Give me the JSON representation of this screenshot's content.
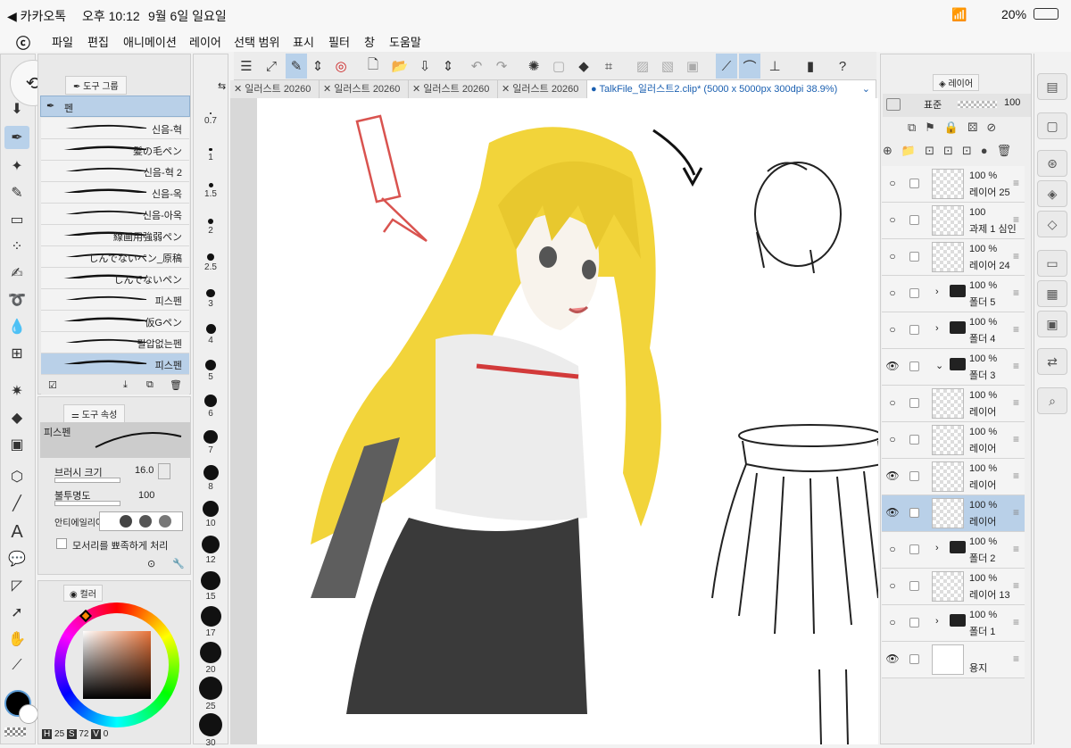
{
  "status_bar": {
    "back": "◀ 카카오톡",
    "time": "오후 10:12",
    "date": "9월 6일 일요일",
    "battery": "20%"
  },
  "menu": [
    "파일",
    "편집",
    "애니메이션",
    "레이어",
    "선택 범위",
    "표시",
    "필터",
    "창",
    "도움말"
  ],
  "sub_tool_panel": {
    "tab": "도구 그룹",
    "group": "펜",
    "brushes": [
      "신음-혁",
      "髪の毛ペン",
      "신음-혁 2",
      "신음-옥",
      "신음-아옥",
      "線画用強弱ペン",
      "しんでないペン_原稿",
      "しんでないペン",
      "피스펜",
      "仮Gペン",
      "필압없는펜",
      "피스펜"
    ]
  },
  "tool_property": {
    "tab": "도구 속성",
    "name": "피스펜",
    "brush_size_label": "브러시 크기",
    "brush_size": "16.0",
    "opacity_label": "불투명도",
    "opacity": "100",
    "antialias_label": "안티에일리어",
    "sharpen_label": "모서리를 뾰족하게 처리"
  },
  "color_panel": {
    "tab": "컬러",
    "h": "25",
    "s": "72",
    "v": "0",
    "h_label": "H",
    "s_label": "S",
    "v_label": "V"
  },
  "brush_size_ruler": [
    "0.7",
    "1",
    "1.5",
    "2",
    "2.5",
    "3",
    "4",
    "5",
    "6",
    "7",
    "8",
    "10",
    "12",
    "15",
    "17",
    "20",
    "25",
    "30"
  ],
  "tabs": [
    "일러스트 20260",
    "일러스트 20260",
    "일러스트 20260",
    "일러스트 20260",
    "TalkFile_일러스트2.clip* (5000 x 5000px 300dpi 38.9%)"
  ],
  "layer_panel": {
    "tab": "레이어",
    "blend": "표준",
    "opacity": "100",
    "layers": [
      {
        "pct": "100 %",
        "name": "레이어 25",
        "type": "layer",
        "visible": false,
        "selected": false
      },
      {
        "pct": "100",
        "name": "과제 1 심인",
        "type": "text",
        "visible": false,
        "selected": false
      },
      {
        "pct": "100 %",
        "name": "레이어 24",
        "type": "layer",
        "visible": false,
        "selected": false
      },
      {
        "pct": "100 %",
        "name": "폴더 5",
        "type": "folder",
        "visible": false,
        "selected": false
      },
      {
        "pct": "100 %",
        "name": "폴더 4",
        "type": "folder",
        "visible": false,
        "selected": false
      },
      {
        "pct": "100 %",
        "name": "폴더 3",
        "type": "folder-open",
        "visible": true,
        "selected": false
      },
      {
        "pct": "100 %",
        "name": "레이어",
        "type": "layer",
        "visible": false,
        "selected": false
      },
      {
        "pct": "100 %",
        "name": "레이어",
        "type": "layer",
        "visible": false,
        "selected": false
      },
      {
        "pct": "100 %",
        "name": "레이어",
        "type": "layer",
        "visible": true,
        "selected": false
      },
      {
        "pct": "100 %",
        "name": "레이어",
        "type": "layer",
        "visible": true,
        "selected": true
      },
      {
        "pct": "100 %",
        "name": "폴더 2",
        "type": "folder",
        "visible": false,
        "selected": false
      },
      {
        "pct": "100 %",
        "name": "레이어 13",
        "type": "layer",
        "visible": false,
        "selected": false
      },
      {
        "pct": "100 %",
        "name": "폴더 1",
        "type": "folder",
        "visible": false,
        "selected": false
      },
      {
        "pct": "",
        "name": "용지",
        "type": "paper",
        "visible": true,
        "selected": false
      }
    ]
  },
  "colors": {
    "accent": "#b9d0e8",
    "hair": "#f2d43a",
    "skirt": "#3a3a3a",
    "arrow": "#d9534f"
  }
}
